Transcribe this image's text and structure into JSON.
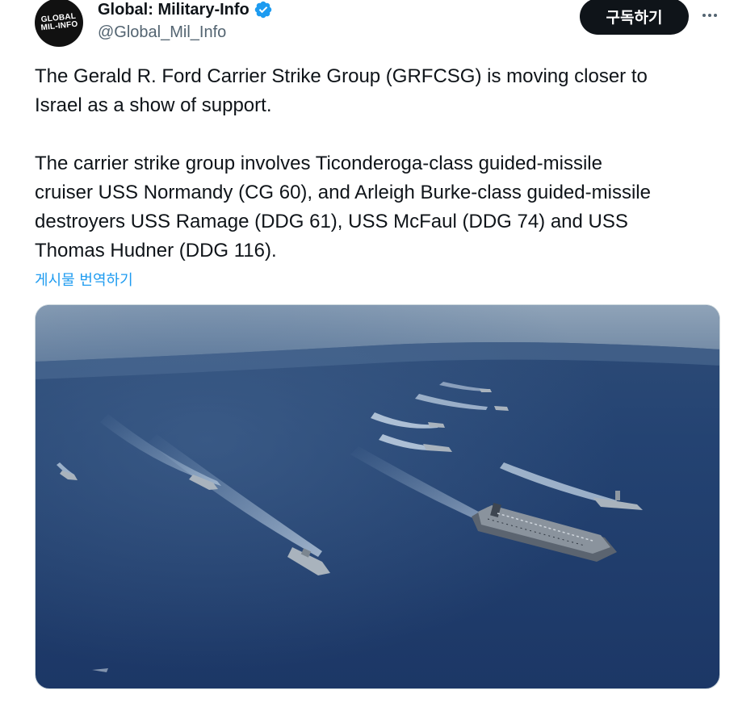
{
  "author": {
    "display_name": "Global: Military-Info",
    "handle": "@Global_Mil_Info",
    "avatar_text_line1": "GLOBAL",
    "avatar_text_line2": "MIL-INFO",
    "verified": true
  },
  "actions": {
    "subscribe_label": "구독하기",
    "more_icon": "more-horizontal-icon"
  },
  "tweet": {
    "paragraph1_line1": "The Gerald R. Ford Carrier Strike Group (GRFCSG) is moving closer to",
    "paragraph1_line2": "Israel as a show of support.",
    "paragraph2_line1": "The carrier strike group involves Ticonderoga-class guided-missile",
    "paragraph2_line2": "cruiser USS Normandy (CG 60), and Arleigh Burke-class guided-missile",
    "paragraph2_line3": "destroyers USS Ramage (DDG 61), USS McFaul (DDG 74) and USS",
    "paragraph2_line4": "Thomas Hudner (DDG 116).",
    "translate_label": "게시물 번역하기"
  },
  "colors": {
    "verified_blue": "#1d9bf0",
    "link_blue": "#1d9bf0",
    "button_dark": "#0f1419",
    "secondary_text": "#536471"
  }
}
